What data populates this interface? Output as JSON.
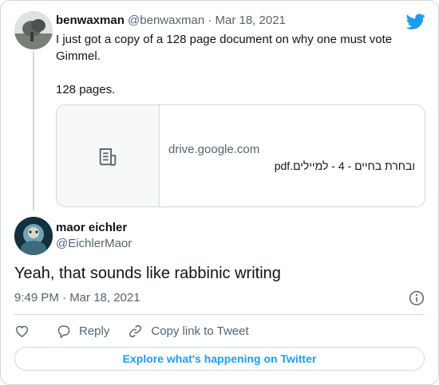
{
  "parent_tweet": {
    "display_name": "benwaxman",
    "handle_date": "@benwaxman · Mar 18, 2021",
    "text_lines": [
      "I just got a copy of a 128 page document on why one must vote Gimmel.",
      "128 pages."
    ],
    "link_card": {
      "domain": "drive.google.com",
      "title": "ובחרת בחיים - 4 - למיילים.pdf",
      "thumbnail_icon": "document-icon"
    }
  },
  "reply_tweet": {
    "display_name": "maor eichler",
    "handle": "@EichlerMaor",
    "text": "Yeah, that sounds like rabbinic writing",
    "timestamp": "9:49 PM · Mar 18, 2021"
  },
  "actions": {
    "like_icon": "heart-icon",
    "reply_label": "Reply",
    "copy_link_label": "Copy link to Tweet"
  },
  "explore_button": "Explore what's happening on Twitter",
  "colors": {
    "twitter_blue": "#1d9bf0",
    "text_primary": "#0f1419",
    "text_secondary": "#536471",
    "border": "#cfd9de"
  }
}
